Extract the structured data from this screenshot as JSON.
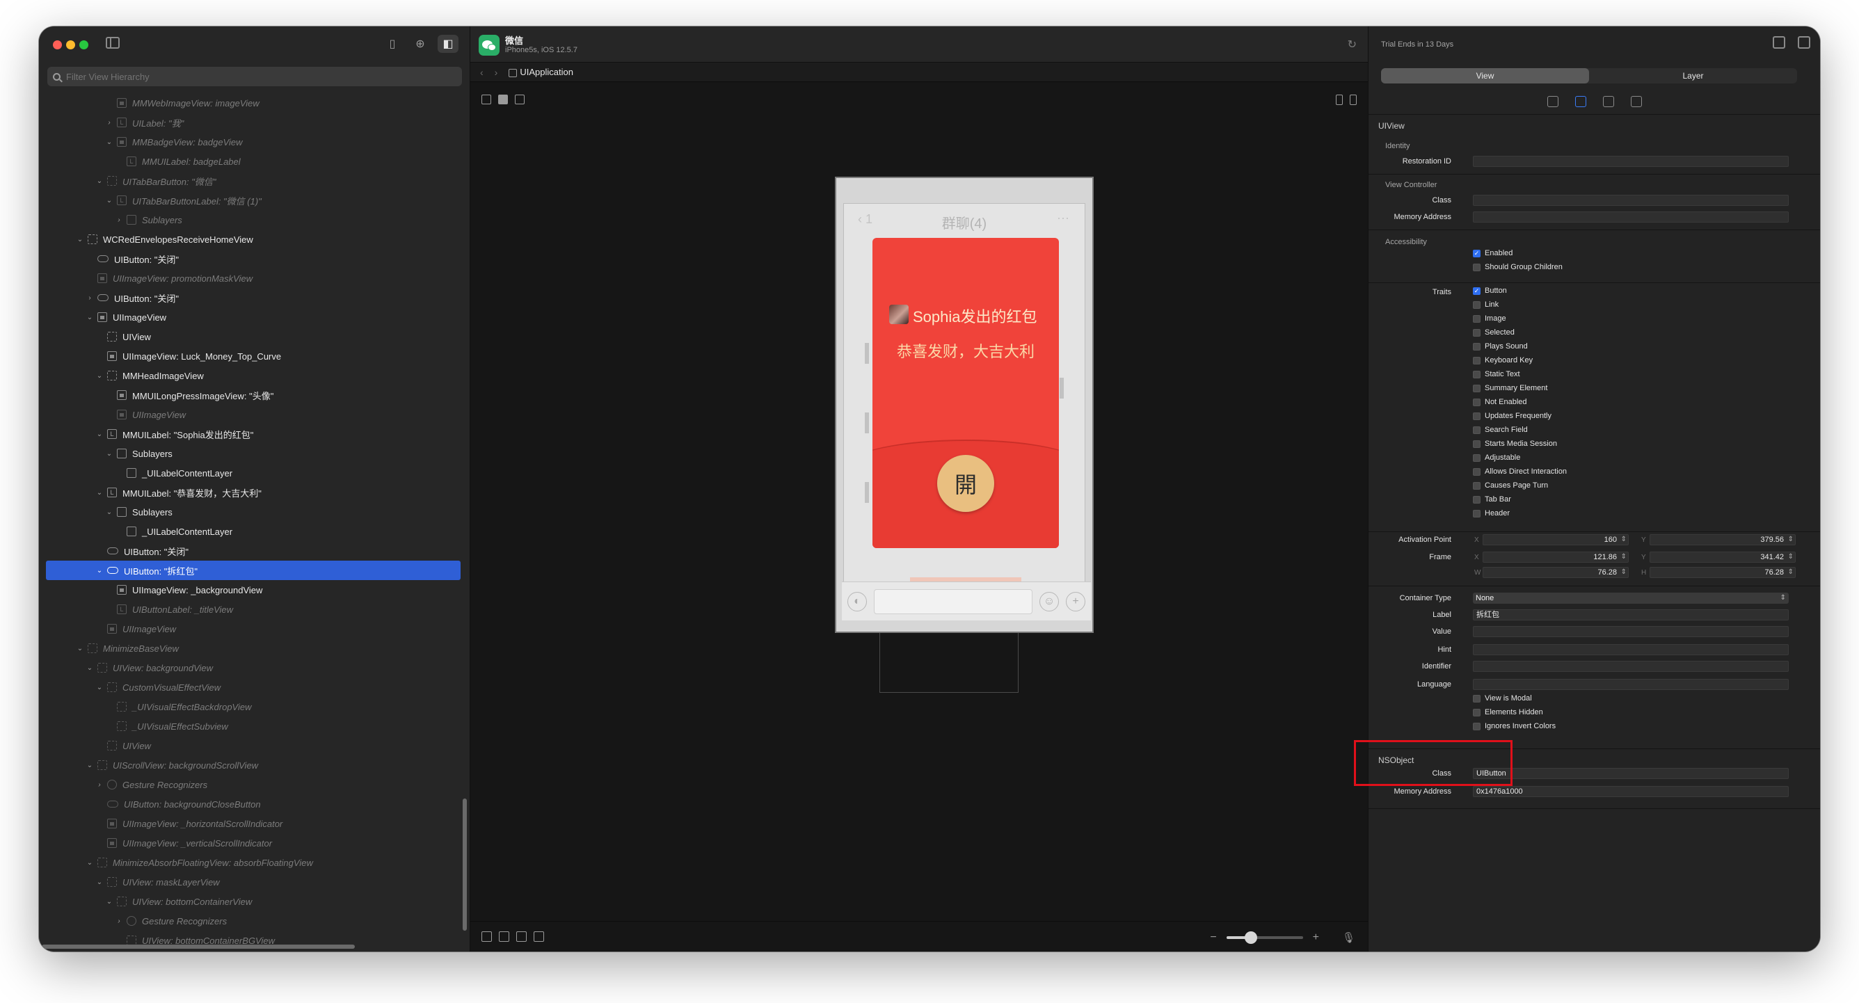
{
  "sidebar": {
    "filter_placeholder": "Filter View Hierarchy",
    "tree": [
      {
        "label": "MMWebImageView: imageView",
        "depth": 4,
        "disc": "",
        "icon": "img",
        "dim": true
      },
      {
        "label": "UILabel: \"我\"",
        "depth": 4,
        "disc": "›",
        "icon": "L",
        "dim": true
      },
      {
        "label": "MMBadgeView: badgeView",
        "depth": 4,
        "disc": "⌄",
        "icon": "img",
        "dim": true
      },
      {
        "label": "MMUILabel: badgeLabel",
        "depth": 5,
        "disc": "",
        "icon": "L",
        "dim": true
      },
      {
        "label": "UITabBarButton: \"微信\"",
        "depth": 3,
        "disc": "⌄",
        "icon": "dashed",
        "dim": true
      },
      {
        "label": "UITabBarButtonLabel: \"微信 (1)\"",
        "depth": 4,
        "disc": "⌄",
        "icon": "L",
        "dim": true
      },
      {
        "label": "Sublayers",
        "depth": 5,
        "disc": "›",
        "icon": "box",
        "dim": true
      },
      {
        "label": "WCRedEnvelopesReceiveHomeView",
        "depth": 1,
        "disc": "⌄",
        "icon": "dashed",
        "dim": false
      },
      {
        "label": "UIButton: \"关闭\"",
        "depth": 2,
        "disc": "",
        "icon": "btn",
        "dim": false
      },
      {
        "label": "UIImageView: promotionMaskView",
        "depth": 2,
        "disc": "",
        "icon": "img",
        "dim": true
      },
      {
        "label": "UIButton: \"关闭\"",
        "depth": 2,
        "disc": "›",
        "icon": "btn",
        "dim": false
      },
      {
        "label": "UIImageView",
        "depth": 2,
        "disc": "⌄",
        "icon": "img",
        "dim": false
      },
      {
        "label": "UIView",
        "depth": 3,
        "disc": "",
        "icon": "dashed",
        "dim": false
      },
      {
        "label": "UIImageView: Luck_Money_Top_Curve",
        "depth": 3,
        "disc": "",
        "icon": "img",
        "dim": false
      },
      {
        "label": "MMHeadImageView",
        "depth": 3,
        "disc": "⌄",
        "icon": "dashed",
        "dim": false
      },
      {
        "label": "MMUILongPressImageView: \"头像\"",
        "depth": 4,
        "disc": "",
        "icon": "img",
        "dim": false
      },
      {
        "label": "UIImageView",
        "depth": 4,
        "disc": "",
        "icon": "img",
        "dim": true
      },
      {
        "label": "MMUILabel: \"Sophia发出的红包\"",
        "depth": 3,
        "disc": "⌄",
        "icon": "L",
        "dim": false
      },
      {
        "label": "Sublayers",
        "depth": 4,
        "disc": "⌄",
        "icon": "box",
        "dim": false
      },
      {
        "label": "_UILabelContentLayer",
        "depth": 5,
        "disc": "",
        "icon": "box",
        "dim": false
      },
      {
        "label": "MMUILabel: \"恭喜发财，大吉大利\"",
        "depth": 3,
        "disc": "⌄",
        "icon": "L",
        "dim": false
      },
      {
        "label": "Sublayers",
        "depth": 4,
        "disc": "⌄",
        "icon": "box",
        "dim": false
      },
      {
        "label": "_UILabelContentLayer",
        "depth": 5,
        "disc": "",
        "icon": "box",
        "dim": false
      },
      {
        "label": "UIButton: \"关闭\"",
        "depth": 3,
        "disc": "",
        "icon": "btn",
        "dim": false
      },
      {
        "label": "UIButton: \"拆红包\"",
        "depth": 3,
        "disc": "⌄",
        "icon": "btn",
        "dim": false,
        "selected": true
      },
      {
        "label": "UIImageView: _backgroundView",
        "depth": 4,
        "disc": "",
        "icon": "img",
        "dim": false
      },
      {
        "label": "UIButtonLabel: _titleView",
        "depth": 4,
        "disc": "",
        "icon": "L",
        "dim": true
      },
      {
        "label": "UIImageView",
        "depth": 3,
        "disc": "",
        "icon": "img",
        "dim": true
      },
      {
        "label": "MinimizeBaseView",
        "depth": 1,
        "disc": "⌄",
        "icon": "dashed",
        "dim": true
      },
      {
        "label": "UIView: backgroundView",
        "depth": 2,
        "disc": "⌄",
        "icon": "dashed",
        "dim": true
      },
      {
        "label": "CustomVisualEffectView",
        "depth": 3,
        "disc": "⌄",
        "icon": "dashed",
        "dim": true
      },
      {
        "label": "_UIVisualEffectBackdropView",
        "depth": 4,
        "disc": "",
        "icon": "dashed",
        "dim": true
      },
      {
        "label": "_UIVisualEffectSubview",
        "depth": 4,
        "disc": "",
        "icon": "dashed",
        "dim": true
      },
      {
        "label": "UIView",
        "depth": 3,
        "disc": "",
        "icon": "dashed",
        "dim": true
      },
      {
        "label": "UIScrollView: backgroundScrollView",
        "depth": 2,
        "disc": "⌄",
        "icon": "dashed",
        "dim": true
      },
      {
        "label": "Gesture Recognizers",
        "depth": 3,
        "disc": "›",
        "icon": "gesture",
        "dim": true
      },
      {
        "label": "UIButton: backgroundCloseButton",
        "depth": 3,
        "disc": "",
        "icon": "btn",
        "dim": true
      },
      {
        "label": "UIImageView: _horizontalScrollIndicator",
        "depth": 3,
        "disc": "",
        "icon": "img",
        "dim": true
      },
      {
        "label": "UIImageView: _verticalScrollIndicator",
        "depth": 3,
        "disc": "",
        "icon": "img",
        "dim": true
      },
      {
        "label": "MinimizeAbsorbFloatingView: absorbFloatingView",
        "depth": 2,
        "disc": "⌄",
        "icon": "dashed",
        "dim": true
      },
      {
        "label": "UIView: maskLayerView",
        "depth": 3,
        "disc": "⌄",
        "icon": "dashed",
        "dim": true
      },
      {
        "label": "UIView: bottomContainerView",
        "depth": 4,
        "disc": "⌄",
        "icon": "dashed",
        "dim": true
      },
      {
        "label": "Gesture Recognizers",
        "depth": 5,
        "disc": "›",
        "icon": "gesture",
        "dim": true
      },
      {
        "label": "UIView: bottomContainerBGView",
        "depth": 5,
        "disc": "",
        "icon": "dashed",
        "dim": true
      }
    ]
  },
  "canvas": {
    "app_name": "微信",
    "device": "iPhone5s, iOS 12.5.7",
    "breadcrumb": "UIApplication",
    "chat_title": "群聊(4)",
    "envelope_title": "Sophia发出的红包",
    "envelope_subtitle": "恭喜发财，大吉大利",
    "open_label": "開",
    "zoom_level": 0.32
  },
  "inspector": {
    "trial": "Trial Ends in 13 Days",
    "tabs": [
      "View",
      "Layer"
    ],
    "section_uiview": "UIView",
    "identity": {
      "title": "Identity",
      "restoration_id_label": "Restoration ID",
      "restoration_id": ""
    },
    "view_controller": {
      "title": "View Controller",
      "class_label": "Class",
      "memory_label": "Memory Address"
    },
    "accessibility": {
      "title": "Accessibility",
      "options": [
        {
          "label": "Enabled",
          "checked": true
        },
        {
          "label": "Should Group Children",
          "checked": false
        }
      ],
      "traits_label": "Traits",
      "traits": [
        {
          "label": "Button",
          "checked": true
        },
        {
          "label": "Link",
          "checked": false
        },
        {
          "label": "Image",
          "checked": false
        },
        {
          "label": "Selected",
          "checked": false
        },
        {
          "label": "Plays Sound",
          "checked": false
        },
        {
          "label": "Keyboard Key",
          "checked": false
        },
        {
          "label": "Static Text",
          "checked": false
        },
        {
          "label": "Summary Element",
          "checked": false
        },
        {
          "label": "Not Enabled",
          "checked": false
        },
        {
          "label": "Updates Frequently",
          "checked": false
        },
        {
          "label": "Search Field",
          "checked": false
        },
        {
          "label": "Starts Media Session",
          "checked": false
        },
        {
          "label": "Adjustable",
          "checked": false
        },
        {
          "label": "Allows Direct Interaction",
          "checked": false
        },
        {
          "label": "Causes Page Turn",
          "checked": false
        },
        {
          "label": "Tab Bar",
          "checked": false
        },
        {
          "label": "Header",
          "checked": false
        }
      ],
      "activation_label": "Activation Point",
      "activation_x": "160",
      "activation_y": "379.56",
      "frame_label": "Frame",
      "frame_x": "121.86",
      "frame_y": "341.42",
      "frame_w": "76.28",
      "frame_h": "76.28",
      "container_label": "Container Type",
      "container_value": "None",
      "label_label": "Label",
      "label_value": "拆红包",
      "value_label": "Value",
      "hint_label": "Hint",
      "identifier_label": "Identifier",
      "language_label": "Language",
      "more_options": [
        {
          "label": "View is Modal",
          "checked": false
        },
        {
          "label": "Elements Hidden",
          "checked": false
        },
        {
          "label": "Ignores Invert Colors",
          "checked": false
        }
      ]
    },
    "nsobject": {
      "title": "NSObject",
      "class_label": "Class",
      "class_value": "UIButton",
      "memory_label": "Memory Address",
      "memory_value": "0x1476a1000"
    },
    "axis": {
      "x": "X",
      "y": "Y",
      "w": "W",
      "h": "H"
    }
  }
}
